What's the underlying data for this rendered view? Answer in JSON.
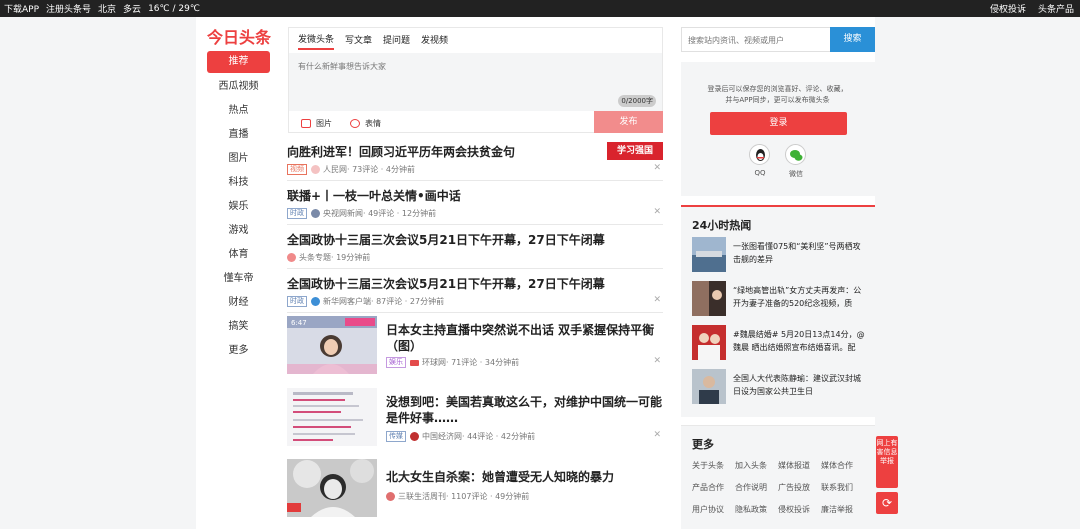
{
  "topbar": {
    "left": [
      "下载APP",
      "注册头条号",
      "北京",
      "多云",
      "16℃ / 29℃"
    ],
    "right": [
      "侵权投诉",
      "头条产品"
    ]
  },
  "logo": "今日头条",
  "nav": [
    "推荐",
    "西瓜视频",
    "热点",
    "直播",
    "图片",
    "科技",
    "娱乐",
    "游戏",
    "体育",
    "懂车帝",
    "财经",
    "搞笑",
    "更多"
  ],
  "post": {
    "tabs": [
      "发微头条",
      "写文章",
      "提问题",
      "发视频"
    ],
    "placeholder": "有什么新鲜事想告诉大家",
    "count": "0/2000字",
    "tool_image": "图片",
    "tool_emoji": "表情",
    "publish": "发布"
  },
  "feed": [
    {
      "title": "向胜利进军！回顾习近平历年两会扶贫金句",
      "tag": "视频",
      "source": "人民网",
      "stats": "· 73评论 · 4分钟前",
      "badge": "学习强国"
    },
    {
      "title": "联播+丨一枝一叶总关情•画中话",
      "tag": "时政",
      "source": "央视网新闻",
      "stats": "· 49评论 · 12分钟前"
    },
    {
      "title": "全国政协十三届三次会议5月21日下午开幕，27日下午闭幕",
      "source": "头条专题",
      "stats": "· 19分钟前"
    },
    {
      "title": "全国政协十三届三次会议5月21日下午开幕，27日下午闭幕",
      "tag": "时政",
      "source": "新华网客户端",
      "stats": "· 87评论 · 27分钟前"
    }
  ],
  "img_feed": [
    {
      "title": "日本女主持直播中突然说不出话 双手紧握保持平衡（图）",
      "tag": "娱乐",
      "source": "环球网",
      "stats": "· 71评论 · 34分钟前",
      "thumb_text": "6:47"
    },
    {
      "title": "没想到吧：美国若真敢这么干，对维护中国统一可能是件好事……",
      "tag": "传媒",
      "source": "中国经济网",
      "stats": "· 44评论 · 42分钟前"
    },
    {
      "title": "北大女生自杀案：她曾遭受无人知晓的暴力",
      "source": "三联生活周刊",
      "stats": "· 1107评论 · 49分钟前"
    }
  ],
  "search": {
    "placeholder": "搜索站内资讯、视频或用户",
    "button": "搜索"
  },
  "login": {
    "desc": "登录后可以保存您的浏览喜好、评论、收藏，并与APP同步，更可以发布微头条",
    "button": "登录",
    "qq": "QQ",
    "wechat": "微信"
  },
  "hot": {
    "heading": "24小时热闻",
    "items": [
      "一张图看懂075和“美利坚”号两栖攻击舰的差异",
      "“绿地高管出轨”女方丈夫再发声：公开为妻子准备的520纪念视频，质",
      "#魏晨结婚# 5月20日13点14分，@魏晨 晒出结婚照宣布结婚喜讯。配",
      "全国人大代表陈静瑜：建议武汉封城日设为国家公共卫生日"
    ]
  },
  "more": {
    "heading": "更多",
    "links": [
      "关于头条",
      "加入头条",
      "媒体报道",
      "媒体合作",
      "产品合作",
      "合作说明",
      "广告投放",
      "联系我们",
      "用户协议",
      "隐私政策",
      "侵权投诉",
      "廉洁举报"
    ]
  },
  "float": {
    "report": "网上有害信息举报",
    "refresh": "⟳"
  }
}
